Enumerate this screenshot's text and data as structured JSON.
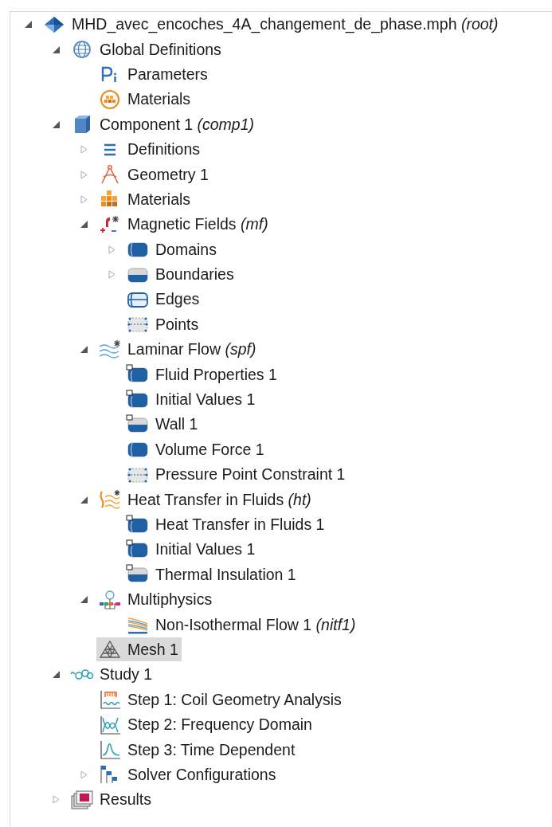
{
  "model_tree": [
    {
      "label": "MHD_avec_encoches_4A_changement_de_phase.mph *(root)*",
      "kind": "model",
      "expanded": true,
      "selected": false,
      "children": [
        {
          "label": "Global Definitions",
          "kind": "globe",
          "expanded": true,
          "selected": false,
          "children": [
            {
              "label": "Parameters",
              "kind": "pi",
              "selected": false
            },
            {
              "label": "Materials",
              "kind": "materials-round",
              "selected": false
            }
          ]
        },
        {
          "label": "Component 1 *(comp1)*",
          "kind": "component",
          "expanded": true,
          "selected": false,
          "children": [
            {
              "label": "Definitions",
              "kind": "list",
              "expanded": false,
              "selected": false
            },
            {
              "label": "Geometry 1",
              "kind": "geometry",
              "expanded": false,
              "selected": false
            },
            {
              "label": "Materials",
              "kind": "materials",
              "expanded": false,
              "selected": false
            },
            {
              "label": "Magnetic Fields *(mf)*",
              "kind": "magnetic",
              "expanded": true,
              "selected": false,
              "children": [
                {
                  "label": "Domains",
                  "kind": "domain",
                  "expanded": false,
                  "selected": false
                },
                {
                  "label": "Boundaries",
                  "kind": "boundary",
                  "expanded": false,
                  "selected": false
                },
                {
                  "label": "Edges",
                  "kind": "edge",
                  "selected": false
                },
                {
                  "label": "Points",
                  "kind": "point",
                  "selected": false
                }
              ]
            },
            {
              "label": "Laminar Flow *(spf)*",
              "kind": "laminar",
              "expanded": true,
              "selected": false,
              "children": [
                {
                  "label": "Fluid Properties 1",
                  "kind": "domain-default",
                  "selected": false
                },
                {
                  "label": "Initial Values 1",
                  "kind": "domain-default",
                  "selected": false
                },
                {
                  "label": "Wall 1",
                  "kind": "boundary-default",
                  "selected": false
                },
                {
                  "label": "Volume Force 1",
                  "kind": "domain",
                  "selected": false
                },
                {
                  "label": "Pressure Point Constraint 1",
                  "kind": "point",
                  "selected": false
                }
              ]
            },
            {
              "label": "Heat Transfer in Fluids *(ht)*",
              "kind": "heat",
              "expanded": true,
              "selected": false,
              "children": [
                {
                  "label": "Heat Transfer in Fluids 1",
                  "kind": "domain-default",
                  "selected": false
                },
                {
                  "label": "Initial Values 1",
                  "kind": "domain-default",
                  "selected": false
                },
                {
                  "label": "Thermal Insulation 1",
                  "kind": "boundary-default",
                  "selected": false
                }
              ]
            },
            {
              "label": "Multiphysics",
              "kind": "multiphysics",
              "expanded": true,
              "selected": false,
              "children": [
                {
                  "label": "Non-Isothermal Flow 1 *(nitf1)*",
                  "kind": "nonisothermal",
                  "selected": false
                }
              ]
            },
            {
              "label": "Mesh 1",
              "kind": "mesh",
              "selected": true
            }
          ]
        },
        {
          "label": "Study 1",
          "kind": "study",
          "expanded": true,
          "selected": false,
          "children": [
            {
              "label": "Step 1: Coil Geometry Analysis",
              "kind": "step-coil",
              "selected": false
            },
            {
              "label": "Step 2: Frequency Domain",
              "kind": "step-frequency",
              "selected": false
            },
            {
              "label": "Step 3: Time Dependent",
              "kind": "step-time",
              "selected": false
            },
            {
              "label": "Solver Configurations",
              "kind": "solver",
              "expanded": false,
              "selected": false
            }
          ]
        },
        {
          "label": "Results",
          "kind": "results",
          "expanded": false,
          "selected": false
        }
      ]
    }
  ]
}
